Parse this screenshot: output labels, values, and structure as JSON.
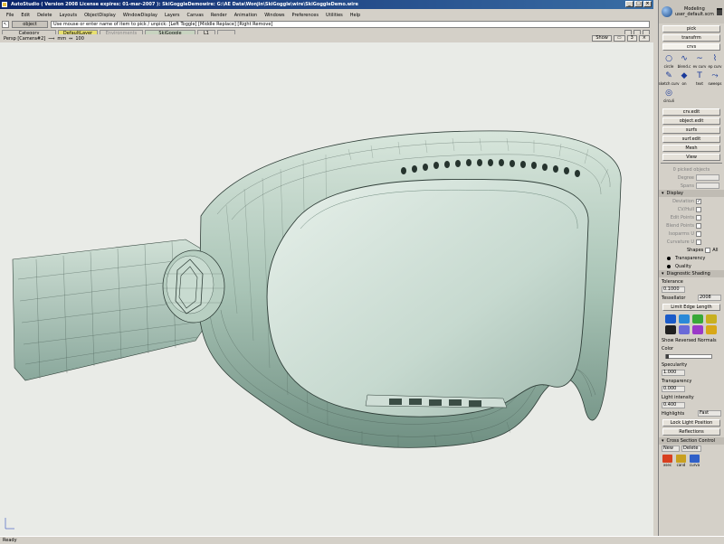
{
  "window": {
    "title": "AutoStudio ( Version 2008  License expires: 01-mar-2007 ): SkiGoggleDemowire: G:\\AE Data\\Wonjin\\SkiGoggle\\wire\\SkiGoggleDemo.wire",
    "controls": [
      "_",
      "□",
      "×"
    ]
  },
  "menubar": {
    "items": [
      "File",
      "Edit",
      "Delete",
      "Layouts",
      "ObjectDisplay",
      "WindowDisplay",
      "Layers",
      "Canvas",
      "Render",
      "Animation",
      "Windows",
      "Preferences",
      "Utilities",
      "Help"
    ]
  },
  "command": {
    "pick_mode": "object",
    "prompt": "Use mouse or enter name of item to pick / unpick: [Left Toggle] [Middle Replace] [Right Remove]"
  },
  "layers": {
    "category": "Category",
    "default": "DefaultLayer",
    "environment": "Environments",
    "ski": "SkiGoggle",
    "l1": "L1",
    "l2": ""
  },
  "viewport": {
    "camera": "Persp [Camera#2]",
    "units": "mm",
    "zoom": "100",
    "show_label": "Show",
    "view_count": "3"
  },
  "palette": {
    "mode": "Modeling",
    "user": "user_default.scm",
    "tabs": [
      "pick",
      "transfrm",
      "crvs"
    ],
    "curve_tools": [
      {
        "label": "circle",
        "icon": "circle-icon"
      },
      {
        "label": "blend.c",
        "icon": "blend-curve-icon"
      },
      {
        "label": "ev curv",
        "icon": "ev-curve-icon"
      },
      {
        "label": "ep curv",
        "icon": "ep-curve-icon"
      },
      {
        "label": "sketch curv",
        "icon": "sketch-curve-icon"
      },
      {
        "label": "on",
        "icon": "on-surface-icon"
      },
      {
        "label": "text",
        "icon": "text-icon"
      },
      {
        "label": "sweeps",
        "icon": "sweeps-icon"
      },
      {
        "label": "circuli",
        "icon": "circuli-icon"
      }
    ],
    "sections": [
      "crv.edit",
      "object.edit",
      "surfs",
      "surf.edit",
      "Mesh",
      "View"
    ],
    "selection_info": "0 picked objects",
    "degree_label": "Degree",
    "spans_label": "Spans",
    "display": {
      "header": "Display",
      "rows": [
        "Deviation",
        "CV/Hull",
        "Edit Points",
        "Blend Points",
        "Isoparms U",
        "Curvature U"
      ],
      "shapes_label": "Shapes",
      "all_label": "All",
      "transparency": "Transparency",
      "quality": "Quality"
    },
    "diag": {
      "header": "Diagnostic Shading",
      "tolerance_label": "Tolerance",
      "tolerance": "0.1000",
      "tessellator_label": "Tessellator",
      "tessellator": "2008",
      "limit_edge": "Limit Edge Length",
      "show_rev": "Show Reversed Normals",
      "color_label": "Color",
      "specularity_label": "Specularity",
      "specularity": "1.000",
      "transparency_label": "Transparency",
      "transparency": "0.000",
      "light_label": "Light intensity",
      "light": "0.400",
      "highlights_label": "Highlights",
      "highlights": "Fast",
      "lock_light": "Lock Light Position",
      "reflections": "Reflections"
    },
    "swatches": [
      "#1a5ac8",
      "#2a8ad8",
      "#38a838",
      "#c8b020",
      "#202020",
      "#6a6ad8",
      "#9a38c8",
      "#d8a818"
    ],
    "cross_section": "Cross Section Control",
    "cs_new": "New",
    "cs_delete": "Delete",
    "bottom_tools": [
      {
        "label": "xsec",
        "color": "#d84020"
      },
      {
        "label": "cand",
        "color": "#c8a020"
      },
      {
        "label": "curva",
        "color": "#3060c8"
      }
    ]
  },
  "status": {
    "text": "Ready"
  }
}
